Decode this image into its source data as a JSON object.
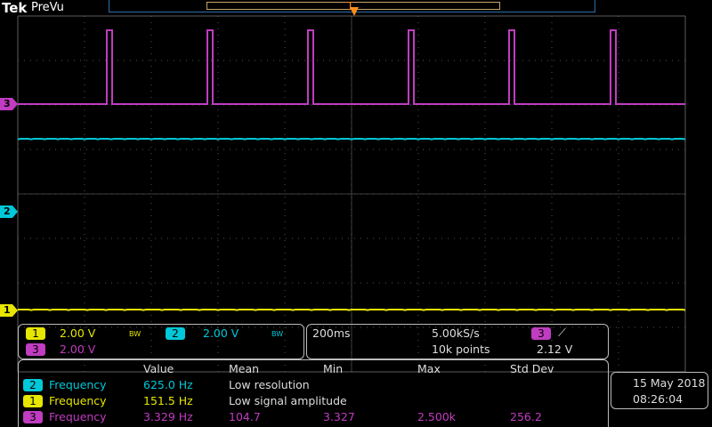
{
  "header": {
    "brand": "Tek",
    "mode": "PreVu",
    "trigger_marker": "T"
  },
  "colors": {
    "ch1": "#e6e600",
    "ch2": "#00c8d8",
    "ch3": "#c03cc0",
    "grid": "#777",
    "trigger": "#ff8c1a"
  },
  "markers": {
    "ch3": "3",
    "ch2": "2",
    "ch1": "1"
  },
  "channels": {
    "ch1": {
      "num": "1",
      "scale": "2.00 V",
      "bw": "BW"
    },
    "ch2": {
      "num": "2",
      "scale": "2.00 V",
      "bw": "BW"
    },
    "ch3": {
      "num": "3",
      "scale": "2.00 V"
    }
  },
  "timebase": {
    "scale": "200ms",
    "rate": "5.00kS/s",
    "points": "10k points",
    "trig_ch": "3",
    "trig_slope": "⟋",
    "trig_level": "2.12 V"
  },
  "measurements": {
    "headers": [
      "Value",
      "Mean",
      "Min",
      "Max",
      "Std Dev"
    ],
    "rows": [
      {
        "ch": "2",
        "name": "Frequency",
        "value": "625.0 Hz",
        "mean": "Low resolution",
        "min": "",
        "max": "",
        "std": ""
      },
      {
        "ch": "1",
        "name": "Frequency",
        "value": "151.5 Hz",
        "mean": "Low signal amplitude",
        "min": "",
        "max": "",
        "std": ""
      },
      {
        "ch": "3",
        "name": "Frequency",
        "value": "3.329 Hz",
        "mean": "104.7",
        "min": "3.327",
        "max": "2.500k",
        "std": "256.2"
      }
    ]
  },
  "datetime": {
    "date": "15 May 2018",
    "time": "08:26:04"
  }
}
